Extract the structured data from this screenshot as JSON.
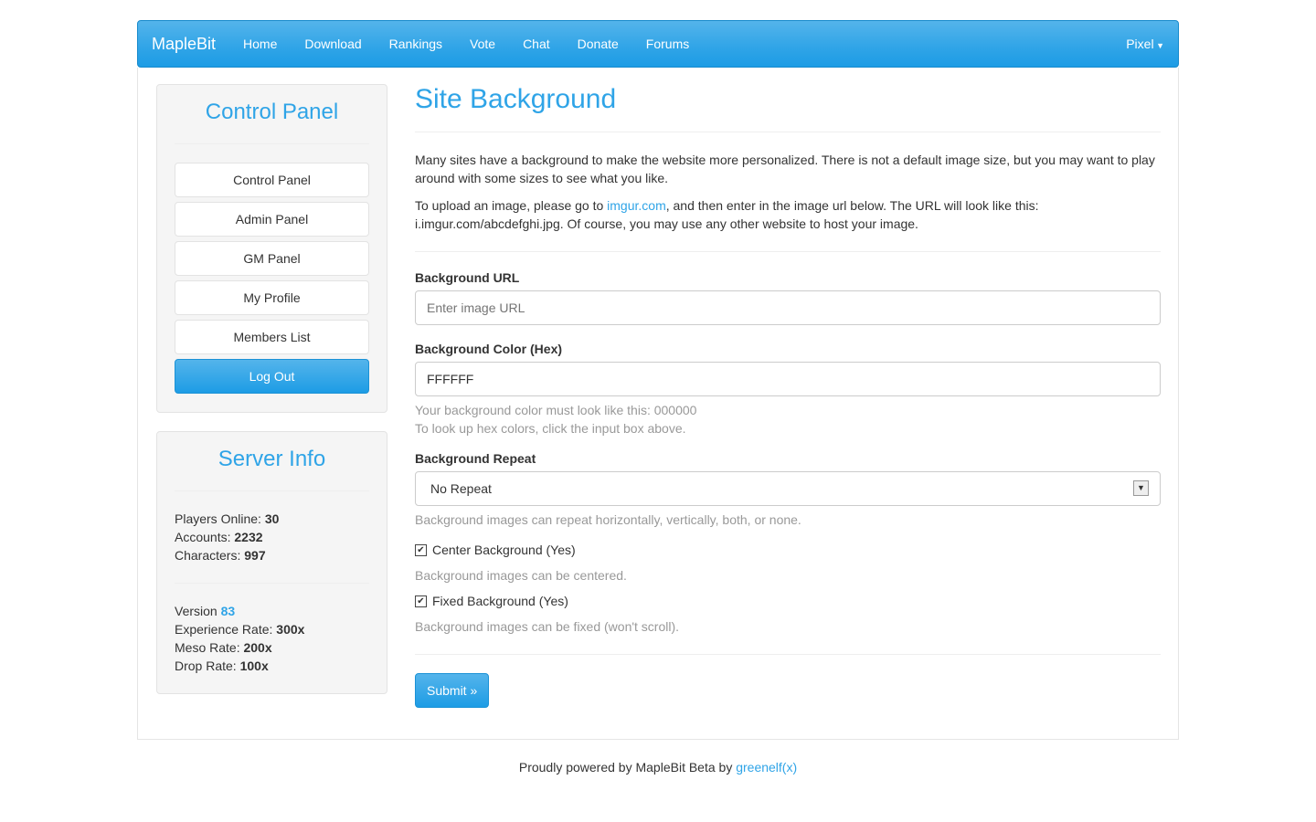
{
  "nav": {
    "brand": "MapleBit",
    "items": [
      "Home",
      "Download",
      "Rankings",
      "Vote",
      "Chat",
      "Donate",
      "Forums"
    ],
    "user": "Pixel"
  },
  "sidebar": {
    "title": "Control Panel",
    "buttons": [
      "Control Panel",
      "Admin Panel",
      "GM Panel",
      "My Profile",
      "Members List"
    ],
    "logout": "Log Out"
  },
  "server": {
    "title": "Server Info",
    "players_label": "Players Online: ",
    "players": "30",
    "accounts_label": "Accounts: ",
    "accounts": "2232",
    "chars_label": "Characters: ",
    "chars": "997",
    "version_label": "Version ",
    "version": "83",
    "exp_label": "Experience Rate: ",
    "exp": "300x",
    "meso_label": "Meso Rate: ",
    "meso": "200x",
    "drop_label": "Drop Rate: ",
    "drop": "100x"
  },
  "main": {
    "title": "Site Background",
    "p1": "Many sites have a background to make the website more personalized. There is not a default image size, but you may want to play around with some sizes to see what you like.",
    "p2a": "To upload an image, please go to ",
    "p2link": "imgur.com",
    "p2b": ", and then enter in the image url below. The URL will look like this: i.imgur.com/abcdefghi.jpg. Of course, you may use any other website to host your image.",
    "url_label": "Background URL",
    "url_placeholder": "Enter image URL",
    "color_label": "Background Color (Hex)",
    "color_value": "FFFFFF",
    "color_help1": "Your background color must look like this: 000000",
    "color_help2": "To look up hex colors, click the input box above.",
    "repeat_label": "Background Repeat",
    "repeat_value": "No Repeat",
    "repeat_help": "Background images can repeat horizontally, vertically, both, or none.",
    "center_label": "Center Background (Yes)",
    "center_checked": true,
    "center_help": "Background images can be centered.",
    "fixed_label": "Fixed Background (Yes)",
    "fixed_checked": true,
    "fixed_help": "Background images can be fixed (won't scroll).",
    "submit": "Submit »"
  },
  "footer": {
    "text": "Proudly powered by MapleBit Beta by ",
    "link": "greenelf(x)"
  }
}
